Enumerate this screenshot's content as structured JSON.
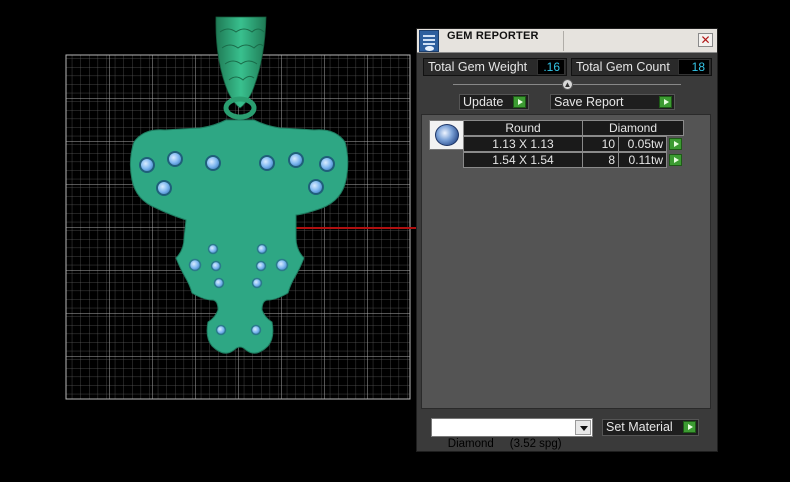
{
  "panel": {
    "title": "GEM REPORTER",
    "close_glyph": "✕",
    "icon": "gem-reporter-app-icon"
  },
  "totals": {
    "weight_label": "Total Gem Weight",
    "weight_value": ".16",
    "count_label": "Total Gem Count",
    "count_value": "18"
  },
  "toolbar": {
    "update_label": "Update",
    "save_report_label": "Save Report",
    "collapse_glyph": "▲"
  },
  "report": {
    "shape_icon": "round-gem-icon",
    "headers": [
      "Round",
      "Diamond"
    ],
    "rows": [
      {
        "size": "1.13 X 1.13",
        "count": "10",
        "weight": "0.05tw"
      },
      {
        "size": "1.54 X 1.54",
        "count": "8",
        "weight": "0.11tw"
      }
    ]
  },
  "material": {
    "selected": "Diamond     (3.52 spg)",
    "set_label": "Set Material"
  },
  "colors": {
    "pendant": "#2ea784",
    "bail": "#2a9e70",
    "stone": "#7fb8f0",
    "grid": "#8a8a8a",
    "value_text": "#34c6e8",
    "play_button": "#3c9b32",
    "cursor_line": "#b01010"
  }
}
